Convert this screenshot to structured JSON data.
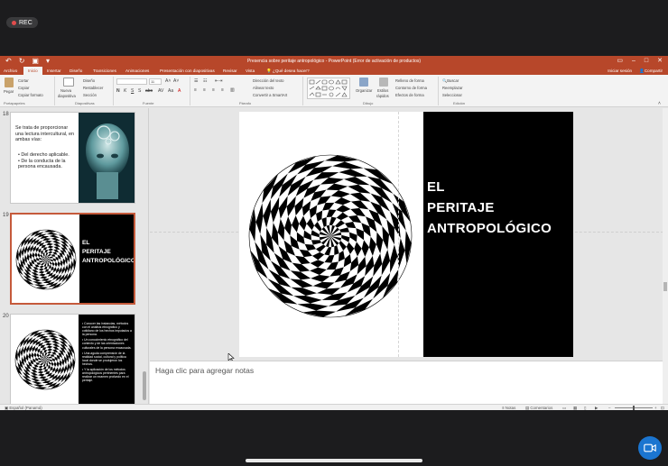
{
  "recording": {
    "label": "REC"
  },
  "window": {
    "title": "Presencia sobre peritaje antropológico - PowerPoint (Error de activación de productos)"
  },
  "tabs": [
    {
      "label": "Archivo"
    },
    {
      "label": "Inicio",
      "active": true
    },
    {
      "label": "Insertar"
    },
    {
      "label": "Diseño"
    },
    {
      "label": "Transiciones"
    },
    {
      "label": "Animaciones"
    },
    {
      "label": "Presentación con diapositivas"
    },
    {
      "label": "Revisar"
    },
    {
      "label": "Vista"
    }
  ],
  "tell_me": "¿Qué desea hacer?",
  "account": {
    "signin": "Iniciar sesión",
    "share": "Compartir"
  },
  "ribbon": {
    "portapapeles": {
      "label": "Portapapeles",
      "paste": "Pegar",
      "cut": "Cortar",
      "copy": "Copiar",
      "format_painter": "Copiar formato"
    },
    "diapositivas": {
      "label": "Diapositivas",
      "new_slide": "Nueva",
      "new_slide2": "diapositiva",
      "layout": "Diseño",
      "reset": "Restablecer",
      "section": "Sección"
    },
    "fuente": {
      "label": "Fuente",
      "size": "11"
    },
    "parrafo": {
      "label": "Párrafo",
      "text_direction": "Dirección del texto",
      "align_text": "Alinear texto",
      "smartart": "Convertir a SmartArt"
    },
    "dibujo": {
      "label": "Dibujo",
      "arrange": "Organizar",
      "quick_styles": "Estilos",
      "quick_styles2": "rápidos",
      "fill": "Relleno de forma",
      "outline": "Contorno de forma",
      "effects": "Efectos de forma"
    },
    "edicion": {
      "label": "Edición",
      "find": "Buscar",
      "replace": "Reemplazar",
      "select": "Seleccionar"
    }
  },
  "slides": [
    {
      "number": "18",
      "intro": "Se trata de proporcionar una lectura intercultural, en ambas vías:",
      "bullets": [
        "Del derecho aplicable.",
        "De la conducta de la persona encausada."
      ]
    },
    {
      "number": "19",
      "title_lines": [
        "EL",
        "PERITAJE",
        "ANTROPOLÓGICO"
      ]
    },
    {
      "number": "20",
      "bullets": [
        "Conocer las instancias, métodos con el análisis etnográfico y cotidiano de los hechos imputados a la persona.",
        "Un conocimiento etnográfico del contexto y de las orientaciones culturales de la persona encausada.",
        "Una aguda comprensión de la realidad social, cultural y política local donde se produjeron los hechos.",
        "Y la aplicación de los métodos antropológicos pertinentes para realizar un examen profundo en el peritaje."
      ]
    }
  ],
  "current_slide": {
    "title_lines": [
      "EL",
      "PERITAJE",
      "ANTROPOLÓGICO"
    ]
  },
  "notes": {
    "placeholder": "Haga clic para agregar notas"
  },
  "status": {
    "language": "Español (Panamá)",
    "notes": "Notas",
    "comments": "Comentarios"
  },
  "colors": {
    "accent": "#b7472a",
    "selection": "#c55a3b",
    "camera": "#1b75d0"
  }
}
